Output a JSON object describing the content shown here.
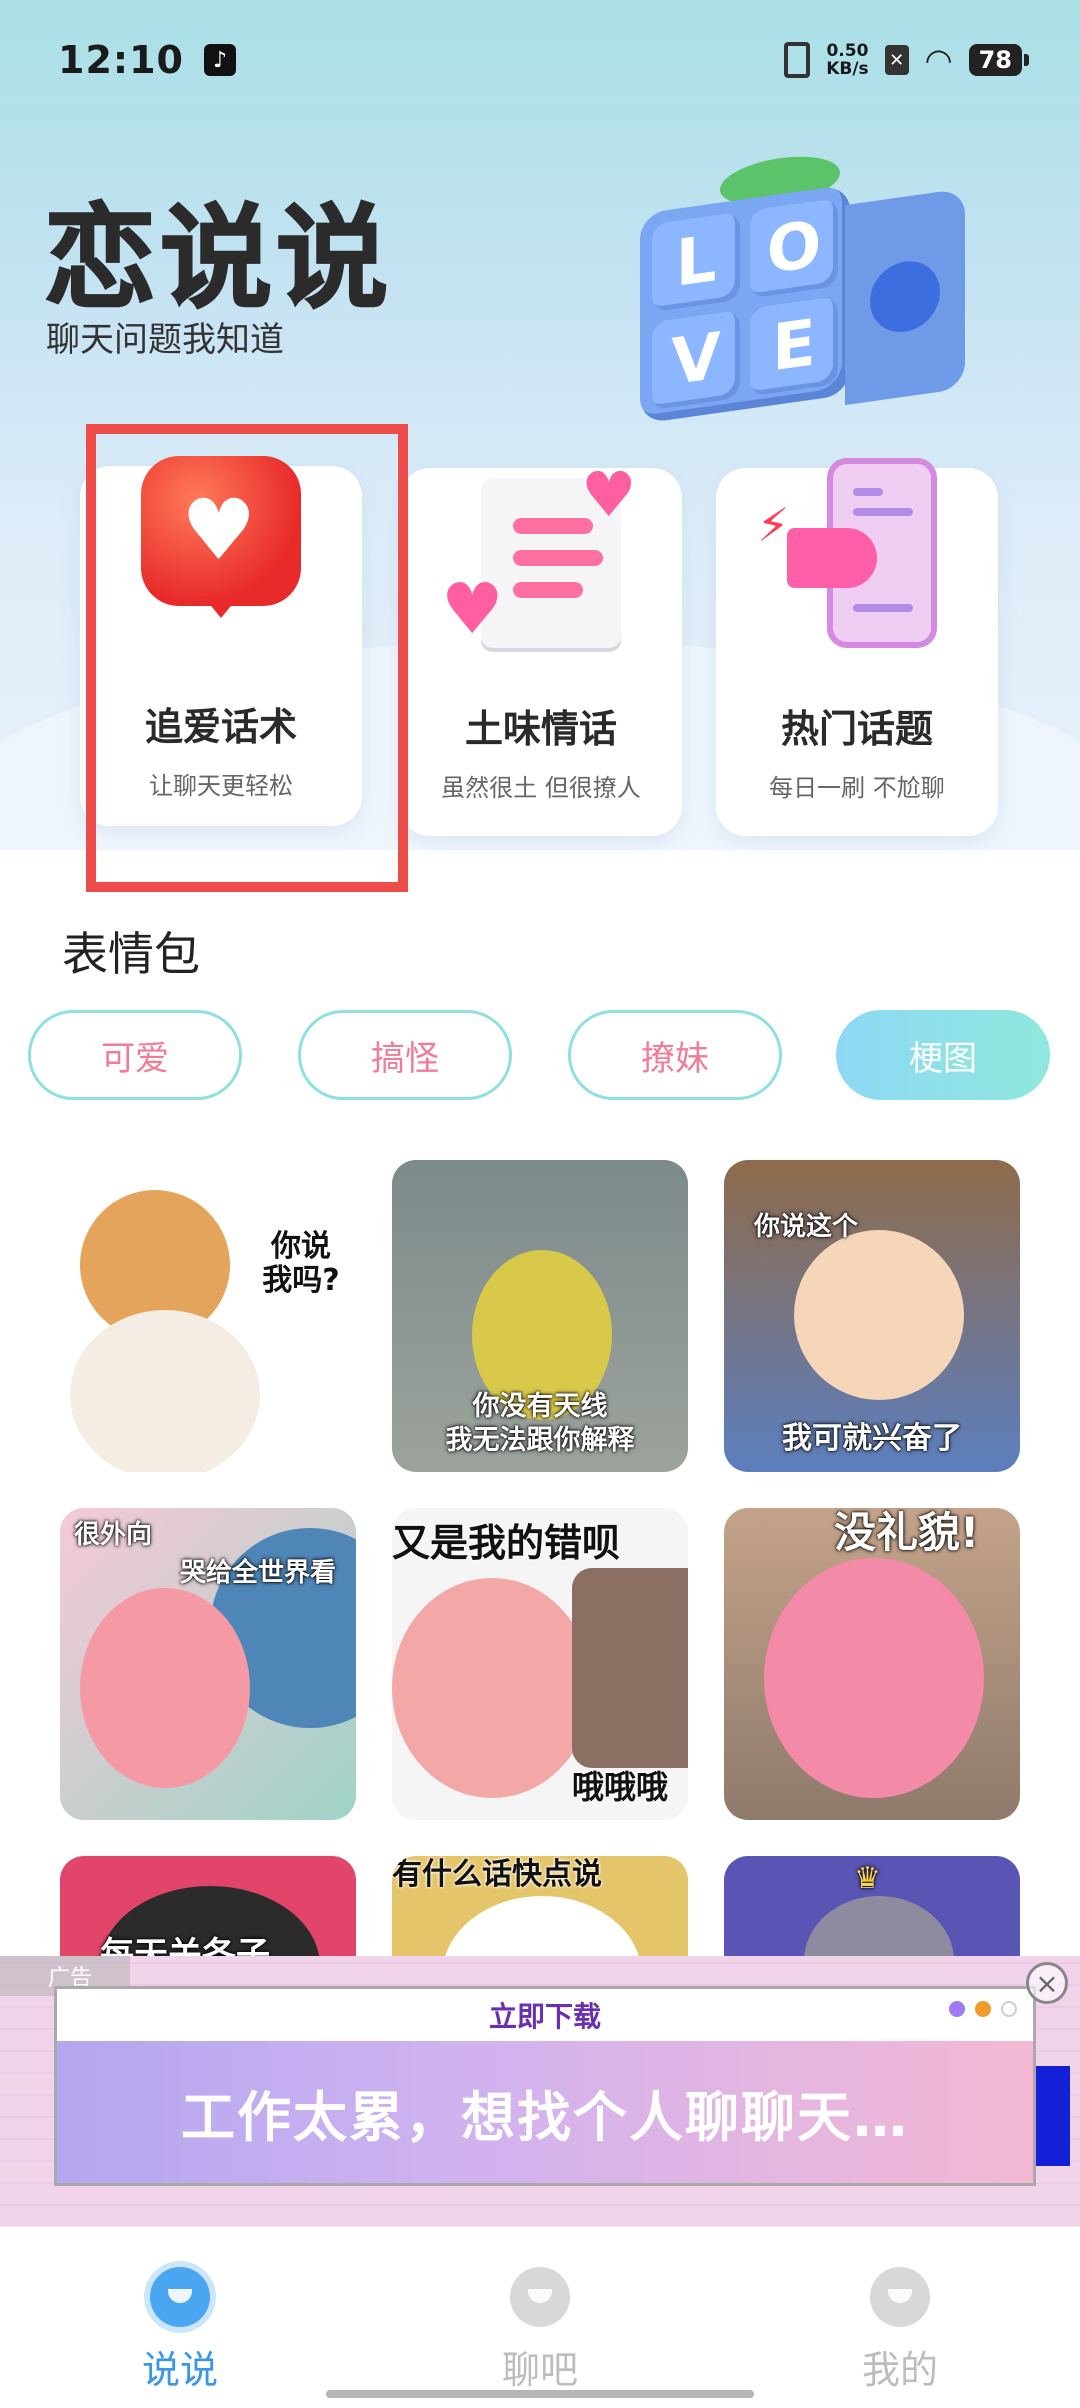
{
  "status_bar": {
    "time": "12:10",
    "net_speed_value": "0.50",
    "net_speed_unit": "KB/s",
    "battery": "78",
    "icons": [
      "tiktok-icon",
      "vibrate-icon",
      "sim-x-icon",
      "wifi-icon",
      "battery-icon"
    ]
  },
  "header": {
    "title": "恋说说",
    "subtitle": "聊天问题我知道",
    "cube_letters": [
      "L",
      "O",
      "V",
      "E"
    ]
  },
  "features": [
    {
      "title": "追爱话术",
      "subtitle": "让聊天更轻松"
    },
    {
      "title": "土味情话",
      "subtitle": "虽然很土 但很撩人"
    },
    {
      "title": "热门话题",
      "subtitle": "每日一刷 不尬聊"
    }
  ],
  "stickers": {
    "section_title": "表情包",
    "tabs": [
      "可爱",
      "搞怪",
      "撩妹",
      "梗图"
    ],
    "active_tab": "梗图",
    "items": [
      {
        "caption": "你说\n我吗?"
      },
      {
        "caption": "你没有天线\n我无法跟你解释"
      },
      {
        "caption_top": "你说这个",
        "caption": "我可就兴奋了"
      },
      {
        "caption_top": "很外向",
        "caption": "哭给全世界看"
      },
      {
        "caption_top": "又是我的错呗",
        "caption": "哦哦哦"
      },
      {
        "caption": "没礼貌!"
      },
      {
        "caption": "每天关各子"
      },
      {
        "caption": "有什么话快点说"
      },
      {
        "caption": ""
      }
    ]
  },
  "ad": {
    "label": "广告",
    "window_title": "立即下载",
    "body": "工作太累，想找个人聊聊天…",
    "close": "×"
  },
  "bottom_nav": {
    "items": [
      {
        "label": "说说",
        "icon": "chat-bubble-icon"
      },
      {
        "label": "聊吧",
        "icon": "planet-icon"
      },
      {
        "label": "我的",
        "icon": "profile-face-icon"
      }
    ],
    "active": "说说"
  },
  "colors": {
    "accent_pink": "#f07c99",
    "tab_border": "#8fe0e1",
    "highlight_red": "#ee4b4b",
    "nav_active": "#3a96e6"
  }
}
